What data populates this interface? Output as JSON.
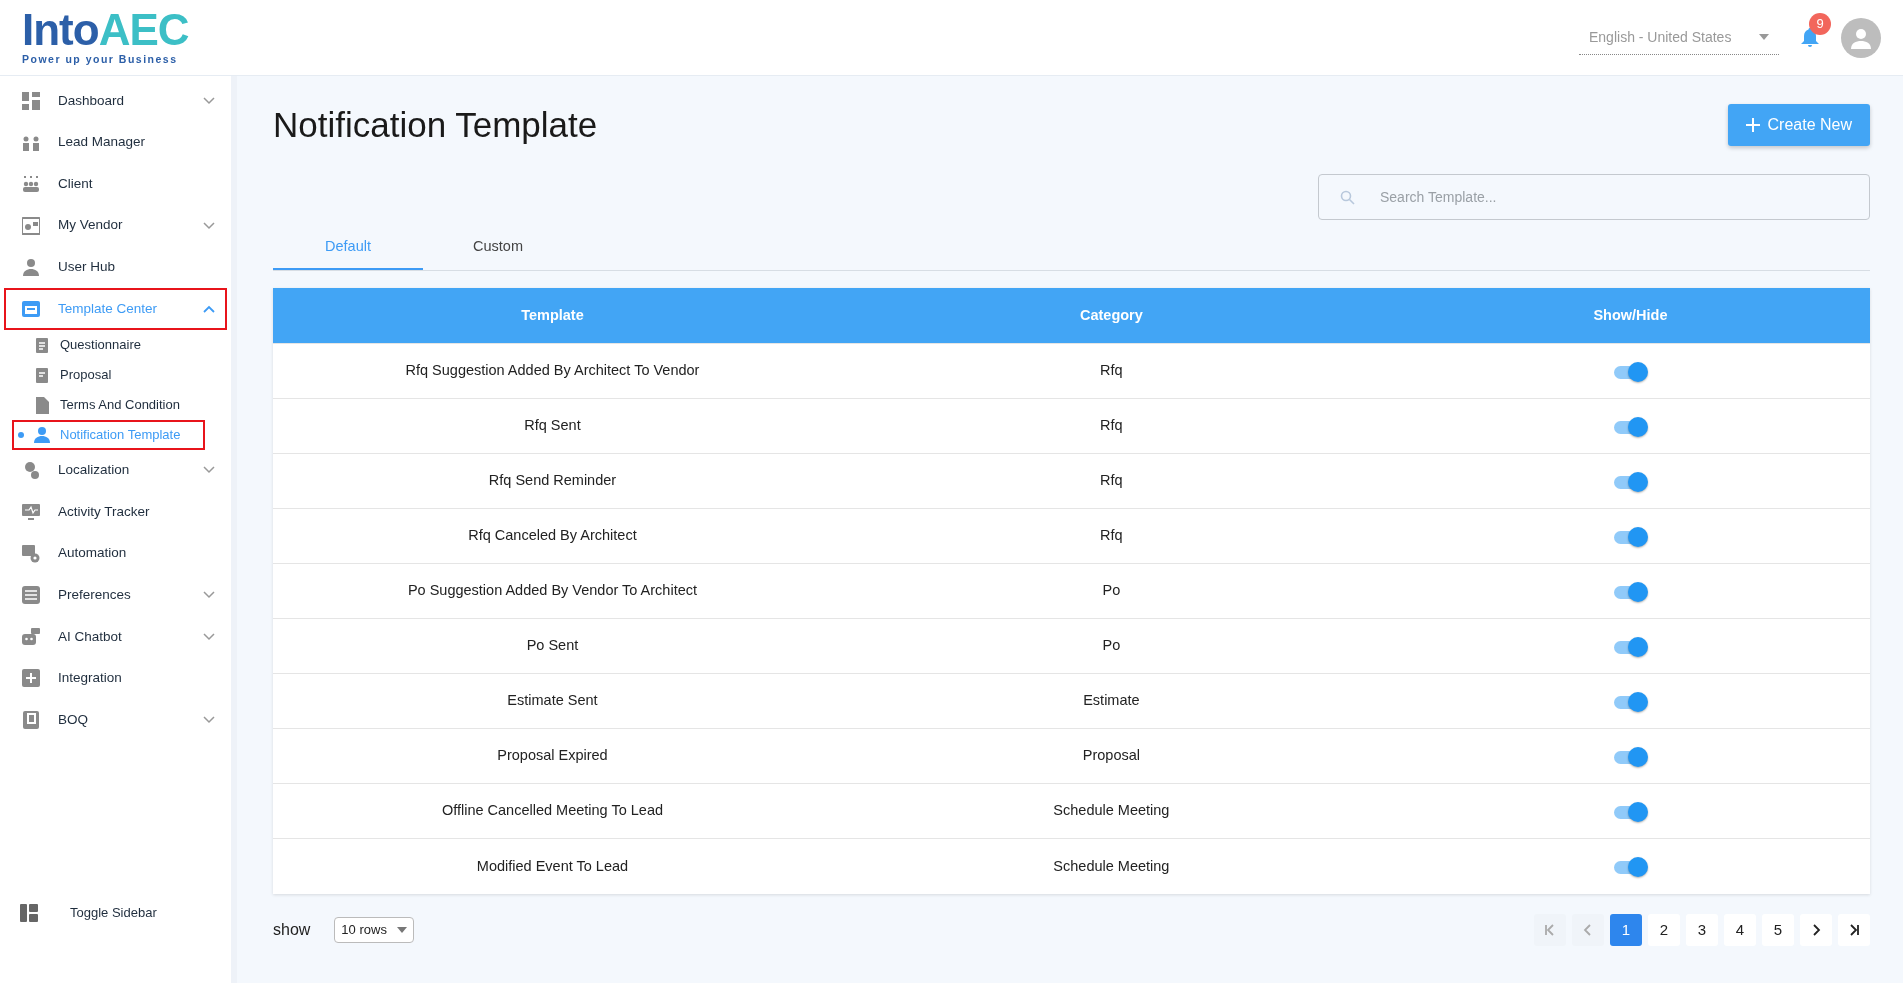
{
  "header": {
    "logo": {
      "brand_dark": "Into",
      "brand_light": "AEC",
      "tagline": "Power up your Business"
    },
    "language": {
      "value": "English - United States"
    },
    "notifications": {
      "count": "9"
    }
  },
  "sidebar": {
    "items": [
      {
        "label": "Dashboard",
        "kind": "group",
        "expanded": false,
        "selected": false,
        "highlighted": false
      },
      {
        "label": "Lead Manager",
        "kind": "link",
        "selected": false,
        "highlighted": false
      },
      {
        "label": "Client",
        "kind": "link",
        "selected": false,
        "highlighted": false
      },
      {
        "label": "My Vendor",
        "kind": "group",
        "expanded": false,
        "selected": false,
        "highlighted": false
      },
      {
        "label": "User Hub",
        "kind": "link",
        "selected": false,
        "highlighted": false
      },
      {
        "label": "Template Center",
        "kind": "group",
        "expanded": true,
        "selected": true,
        "highlighted": true,
        "children": [
          {
            "label": "Questionnaire",
            "selected": false,
            "highlighted": false
          },
          {
            "label": "Proposal",
            "selected": false,
            "highlighted": false
          },
          {
            "label": "Terms And Condition",
            "selected": false,
            "highlighted": false
          },
          {
            "label": "Notification Template",
            "selected": true,
            "highlighted": true
          }
        ]
      },
      {
        "label": "Localization",
        "kind": "group",
        "expanded": false,
        "selected": false,
        "highlighted": false
      },
      {
        "label": "Activity Tracker",
        "kind": "link",
        "selected": false,
        "highlighted": false
      },
      {
        "label": "Automation",
        "kind": "link",
        "selected": false,
        "highlighted": false
      },
      {
        "label": "Preferences",
        "kind": "group",
        "expanded": false,
        "selected": false,
        "highlighted": false
      },
      {
        "label": "AI Chatbot",
        "kind": "group",
        "expanded": false,
        "selected": false,
        "highlighted": false
      },
      {
        "label": "Integration",
        "kind": "link",
        "selected": false,
        "highlighted": false
      },
      {
        "label": "BOQ",
        "kind": "group",
        "expanded": false,
        "selected": false,
        "highlighted": false
      }
    ],
    "toggle": {
      "label": "Toggle Sidebar"
    }
  },
  "page": {
    "title": "Notification Template",
    "create_button": "Create New",
    "search": {
      "placeholder": "Search Template..."
    },
    "tabs": [
      {
        "label": "Default",
        "selected": true
      },
      {
        "label": "Custom",
        "selected": false
      }
    ],
    "table": {
      "columns": [
        "Template",
        "Category",
        "Show/Hide"
      ],
      "rows": [
        {
          "template": "Rfq Suggestion Added By Architect To Vendor",
          "category": "Rfq",
          "on": true
        },
        {
          "template": "Rfq Sent",
          "category": "Rfq",
          "on": true
        },
        {
          "template": "Rfq Send Reminder",
          "category": "Rfq",
          "on": true
        },
        {
          "template": "Rfq Canceled By Architect",
          "category": "Rfq",
          "on": true
        },
        {
          "template": "Po Suggestion Added By Vendor To Architect",
          "category": "Po",
          "on": true
        },
        {
          "template": "Po Sent",
          "category": "Po",
          "on": true
        },
        {
          "template": "Estimate Sent",
          "category": "Estimate",
          "on": true
        },
        {
          "template": "Proposal Expired",
          "category": "Proposal",
          "on": true
        },
        {
          "template": "Offline Cancelled Meeting To Lead",
          "category": "Schedule Meeting",
          "on": true
        },
        {
          "template": "Modified Event To Lead",
          "category": "Schedule Meeting",
          "on": true
        }
      ]
    },
    "rows_per_page": {
      "label": "show",
      "value": "10 rows"
    },
    "pagination": {
      "first_disabled": true,
      "prev_disabled": true,
      "next_disabled": false,
      "last_disabled": false,
      "pages": [
        {
          "label": "1",
          "selected": true
        },
        {
          "label": "2",
          "selected": false
        },
        {
          "label": "3",
          "selected": false
        },
        {
          "label": "4",
          "selected": false
        },
        {
          "label": "5",
          "selected": false
        }
      ]
    }
  }
}
